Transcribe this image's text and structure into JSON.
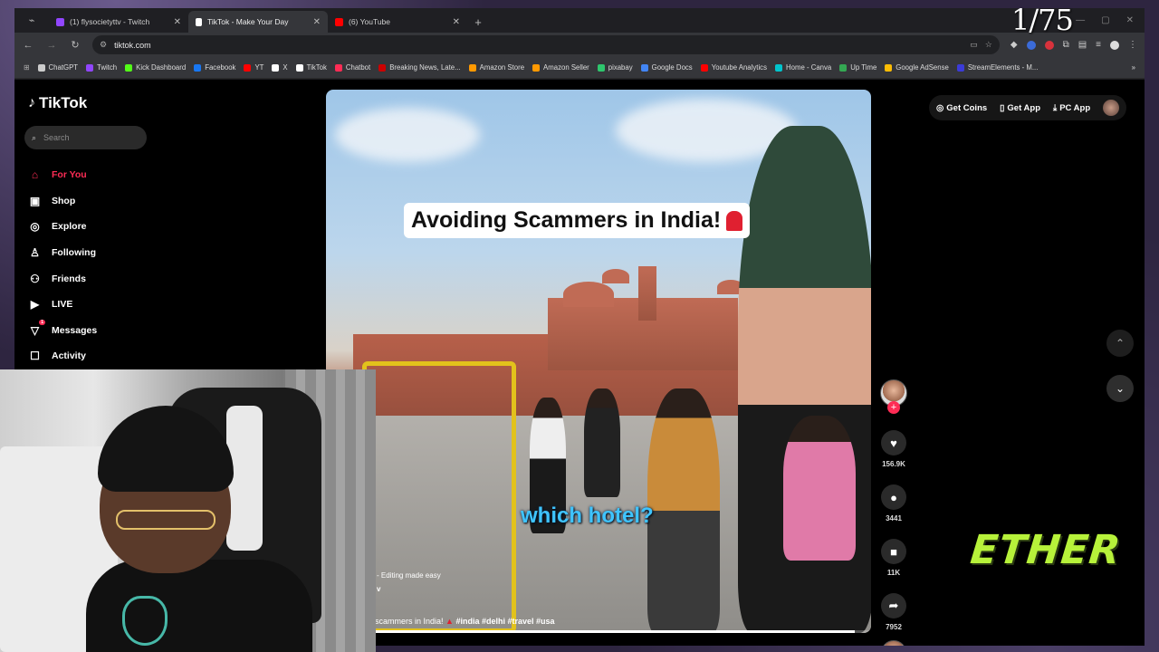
{
  "browser": {
    "tabs": [
      {
        "title": "(1) flysocietyttv - Twitch",
        "color": "#9146ff"
      },
      {
        "title": "TikTok - Make Your Day",
        "color": "#ffffff"
      },
      {
        "title": "(6) YouTube",
        "color": "#ff0000"
      }
    ],
    "url": "tiktok.com",
    "bookmarks": [
      {
        "label": "ChatGPT",
        "color": "#cccccc"
      },
      {
        "label": "Twitch",
        "color": "#9146ff"
      },
      {
        "label": "Kick Dashboard",
        "color": "#53fc18"
      },
      {
        "label": "Facebook",
        "color": "#1877f2"
      },
      {
        "label": "YT",
        "color": "#ff0000"
      },
      {
        "label": "X",
        "color": "#ffffff"
      },
      {
        "label": "TikTok",
        "color": "#ffffff"
      },
      {
        "label": "Chatbot",
        "color": "#fe2c55"
      },
      {
        "label": "Breaking News, Late...",
        "color": "#cc0000"
      },
      {
        "label": "Amazon Store",
        "color": "#ff9900"
      },
      {
        "label": "Amazon Seller",
        "color": "#ff9900"
      },
      {
        "label": "pixabay",
        "color": "#2ec66d"
      },
      {
        "label": "Google Docs",
        "color": "#4285f4"
      },
      {
        "label": "Youtube Analytics",
        "color": "#ff0000"
      },
      {
        "label": "Home - Canva",
        "color": "#00c4cc"
      },
      {
        "label": "Up Time",
        "color": "#34a853"
      },
      {
        "label": "Google AdSense",
        "color": "#fbbc04"
      },
      {
        "label": "StreamElements - M...",
        "color": "#3b3bd8"
      }
    ]
  },
  "tiktok": {
    "logo": "TikTok",
    "search_placeholder": "Search",
    "nav": [
      {
        "label": "For You",
        "icon": "home-icon",
        "active": true
      },
      {
        "label": "Shop",
        "icon": "shop-icon"
      },
      {
        "label": "Explore",
        "icon": "compass-icon"
      },
      {
        "label": "Following",
        "icon": "following-icon"
      },
      {
        "label": "Friends",
        "icon": "friends-icon"
      },
      {
        "label": "LIVE",
        "icon": "live-icon"
      },
      {
        "label": "Messages",
        "icon": "messages-icon",
        "badge": "1"
      },
      {
        "label": "Activity",
        "icon": "activity-icon"
      }
    ],
    "top_right": {
      "get_coins": "Get Coins",
      "get_app": "Get App",
      "pc_app": "PC App"
    },
    "video": {
      "title_caption": "Avoiding Scammers in India!",
      "subtitle": "which hotel?",
      "meta_line1": "- Editing made easy",
      "meta_line2": "v",
      "caption_text": "scammers in India! ",
      "caption_tags": "#india #delhi #travel #usa",
      "progress": 0.97
    },
    "stats": {
      "likes": "156.9K",
      "comments": "3441",
      "saves": "11K",
      "shares": "7952"
    },
    "accent": "#fe2c55"
  },
  "overlay": {
    "counter": "1/75",
    "brand": "ETHER"
  }
}
